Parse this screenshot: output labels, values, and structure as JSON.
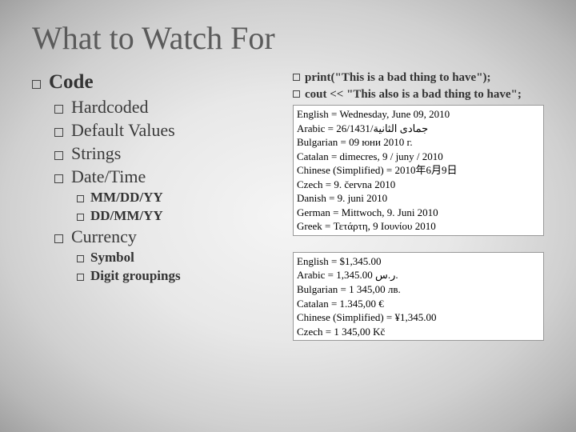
{
  "title": "What to Watch For",
  "left": {
    "l1": "Code",
    "l1_items": [
      "Hardcoded",
      "Default Values",
      "Strings",
      "Date/Time"
    ],
    "l1_sub4": [
      "MM/DD/YY",
      "DD/MM/YY"
    ],
    "l1_5": "Currency",
    "l1_5_sub": [
      "Symbol",
      "Digit groupings"
    ]
  },
  "right": {
    "line1": "print(\"This is a bad thing to have\");",
    "line2": "cout << \"This also is a bad thing to have\";",
    "dates": [
      "English = Wednesday, June 09, 2010",
      "Arabic = 26/1431/جمادى الثانية",
      "Bulgarian = 09 юни 2010 г.",
      "Catalan = dimecres, 9 / juny / 2010",
      "Chinese (Simplified) = 2010年6月9日",
      "Czech = 9. června 2010",
      "Danish = 9. juni 2010",
      "German = Mittwoch, 9. Juni 2010",
      "Greek = Τετάρτη, 9 Ιουνίου 2010"
    ],
    "currency": [
      "English = $1,345.00",
      "Arabic = 1,345.00 ر.س.",
      "Bulgarian = 1 345,00 лв.",
      "Catalan = 1.345,00 €",
      "Chinese (Simplified) = ¥1,345.00",
      "Czech = 1 345,00 Kč"
    ]
  }
}
